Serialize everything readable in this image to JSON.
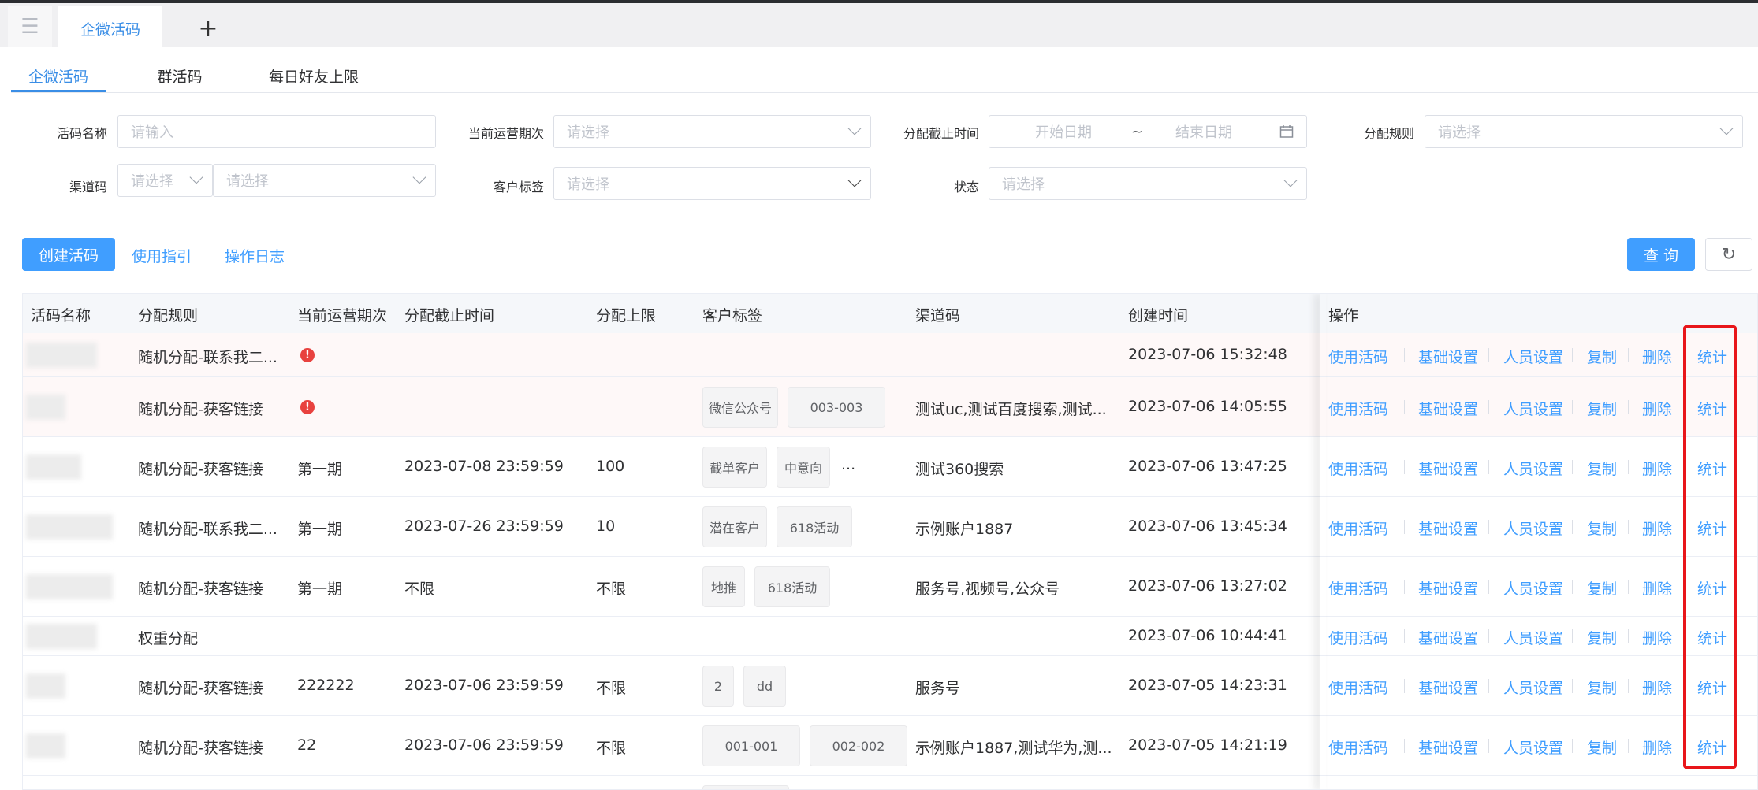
{
  "tabs": {
    "active_label": "企微活码",
    "add_label": "+"
  },
  "subtabs": [
    "企微活码",
    "群活码",
    "每日好友上限"
  ],
  "filters": {
    "name_label": "活码名称",
    "name_placeholder": "请输入",
    "period_label": "当前运营期次",
    "period_placeholder": "请选择",
    "deadline_label": "分配截止时间",
    "start_placeholder": "开始日期",
    "range_sep": "~",
    "end_placeholder": "结束日期",
    "rule_label": "分配规则",
    "rule_placeholder": "请选择",
    "channel_label": "渠道码",
    "channel_placeholder_1": "请选择",
    "channel_placeholder_2": "请选择",
    "tag_label": "客户标签",
    "tag_placeholder": "请选择",
    "status_label": "状态",
    "status_placeholder": "请选择"
  },
  "toolbar": {
    "create_label": "创建活码",
    "guide_label": "使用指引",
    "log_label": "操作日志",
    "query_label": "查 询"
  },
  "table": {
    "headers": [
      "活码名称",
      "分配规则",
      "当前运营期次",
      "分配截止时间",
      "分配上限",
      "客户标签",
      "渠道码",
      "创建时间",
      "操作"
    ],
    "operations": [
      "使用活码",
      "基础设置",
      "人员设置",
      "复制",
      "删除",
      "统计"
    ],
    "rows": [
      {
        "rule": "随机分配-联系我二...",
        "period": "",
        "warn": true,
        "deadline": "",
        "limit": "",
        "tags": [],
        "tags_more": "",
        "channel": "",
        "created": "2023-07-06 15:32:48"
      },
      {
        "rule": "随机分配-获客链接",
        "period": "",
        "warn": true,
        "deadline": "",
        "limit": "",
        "tags": [
          "微信公众号",
          "003-003"
        ],
        "tags_more": "",
        "channel": "测试uc,测试百度搜索,测试...",
        "created": "2023-07-06 14:05:55"
      },
      {
        "rule": "随机分配-获客链接",
        "period": "第一期",
        "warn": false,
        "deadline": "2023-07-08 23:59:59",
        "limit": "100",
        "tags": [
          "截单客户",
          "中意向"
        ],
        "tags_more": "...",
        "channel": "测试360搜索",
        "created": "2023-07-06 13:47:25"
      },
      {
        "rule": "随机分配-联系我二...",
        "period": "第一期",
        "warn": false,
        "deadline": "2023-07-26 23:59:59",
        "limit": "10",
        "tags": [
          "潜在客户",
          "618活动"
        ],
        "tags_more": "",
        "channel": "示例账户1887",
        "created": "2023-07-06 13:45:34"
      },
      {
        "rule": "随机分配-获客链接",
        "period": "第一期",
        "warn": false,
        "deadline": "不限",
        "limit": "不限",
        "tags": [
          "地推",
          "618活动"
        ],
        "tags_more": "",
        "channel": "服务号,视频号,公众号",
        "created": "2023-07-06 13:27:02"
      },
      {
        "rule": "权重分配",
        "period": "",
        "warn": false,
        "deadline": "",
        "limit": "",
        "tags": [],
        "tags_more": "",
        "channel": "",
        "created": "2023-07-06 10:44:41"
      },
      {
        "rule": "随机分配-获客链接",
        "period": "222222",
        "warn": false,
        "deadline": "2023-07-06 23:59:59",
        "limit": "不限",
        "tags": [
          "2",
          "dd"
        ],
        "tags_more": "",
        "channel": "服务号",
        "created": "2023-07-05 14:23:31"
      },
      {
        "rule": "随机分配-获客链接",
        "period": "22",
        "warn": false,
        "deadline": "2023-07-06 23:59:59",
        "limit": "不限",
        "tags": [
          "001-001",
          "002-002"
        ],
        "tags_more": "...",
        "channel": "示例账户1887,测试华为,测...",
        "created": "2023-07-05 14:21:19"
      }
    ]
  },
  "colors": {
    "primary": "#409eff",
    "highlight": "#e8161a",
    "warn": "#e8423f"
  }
}
